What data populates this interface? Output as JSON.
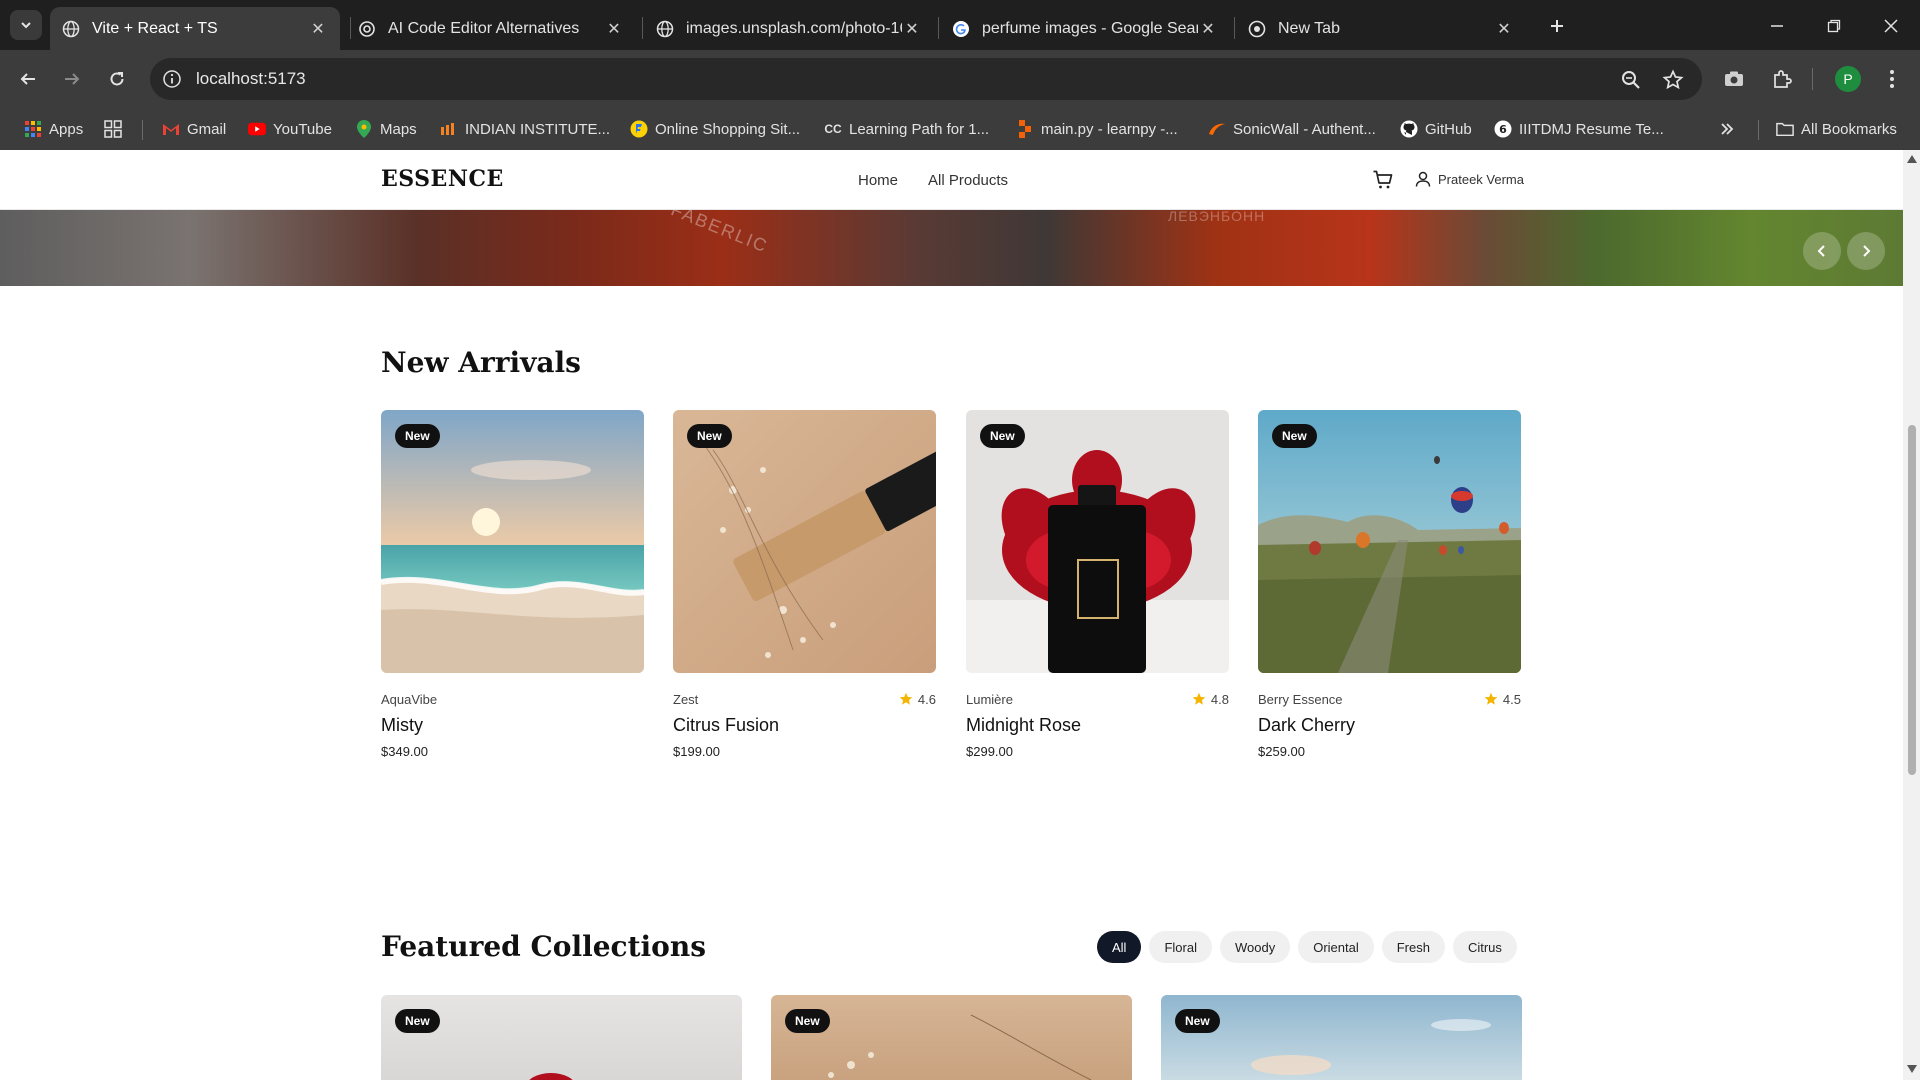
{
  "browser": {
    "tabs": [
      {
        "title": "Vite + React + TS",
        "active": true,
        "icon": "globe-icon"
      },
      {
        "title": "AI Code Editor Alternatives",
        "active": false,
        "icon": "openai-icon"
      },
      {
        "title": "images.unsplash.com/photo-16",
        "active": false,
        "icon": "globe-icon"
      },
      {
        "title": "perfume images - Google Searc",
        "active": false,
        "icon": "google-icon"
      },
      {
        "title": "New Tab",
        "active": false,
        "icon": "chrome-icon"
      }
    ],
    "url": "localhost:5173",
    "profile_initial": "P",
    "bookmarks": [
      {
        "label": "Apps",
        "icon": "apps-grid-icon"
      },
      {
        "label": "Gmail",
        "icon": "gmail-icon"
      },
      {
        "label": "YouTube",
        "icon": "youtube-icon"
      },
      {
        "label": "Maps",
        "icon": "maps-icon"
      },
      {
        "label": "INDIAN INSTITUTE...",
        "icon": "institute-icon"
      },
      {
        "label": "Online Shopping Sit...",
        "icon": "flipkart-icon"
      },
      {
        "label": "Learning Path for 1...",
        "icon": "cc-icon"
      },
      {
        "label": "main.py - learnpy -...",
        "icon": "replit-icon"
      },
      {
        "label": "SonicWall - Authent...",
        "icon": "sonicwall-icon"
      },
      {
        "label": "GitHub",
        "icon": "github-icon"
      },
      {
        "label": "IIITDMJ Resume Te...",
        "icon": "resume-icon"
      }
    ],
    "all_bookmarks_label": "All Bookmarks"
  },
  "site": {
    "logo": "ESSENCE",
    "nav": [
      {
        "label": "Home"
      },
      {
        "label": "All Products"
      }
    ],
    "user_name": "Prateek Verma",
    "hero_text_1": "FABERLIC",
    "hero_text_2": "ЛЕВЭНБОНН"
  },
  "new_arrivals": {
    "title": "New Arrivals",
    "products": [
      {
        "badge": "New",
        "brand": "AquaVibe",
        "name": "Misty",
        "price": "$349.00",
        "rating": ""
      },
      {
        "badge": "New",
        "brand": "Zest",
        "name": "Citrus Fusion",
        "price": "$199.00",
        "rating": "4.6"
      },
      {
        "badge": "New",
        "brand": "Lumière",
        "name": "Midnight Rose",
        "price": "$299.00",
        "rating": "4.8"
      },
      {
        "badge": "New",
        "brand": "Berry Essence",
        "name": "Dark Cherry",
        "price": "$259.00",
        "rating": "4.5"
      }
    ]
  },
  "featured": {
    "title": "Featured Collections",
    "filters": [
      "All",
      "Floral",
      "Woody",
      "Oriental",
      "Fresh",
      "Citrus"
    ],
    "active_filter": "All",
    "badges": [
      "New",
      "New",
      "New"
    ]
  },
  "colors": {
    "accent_dark": "#111827",
    "star": "#f5b400",
    "profile_green": "#1e8e3e"
  }
}
